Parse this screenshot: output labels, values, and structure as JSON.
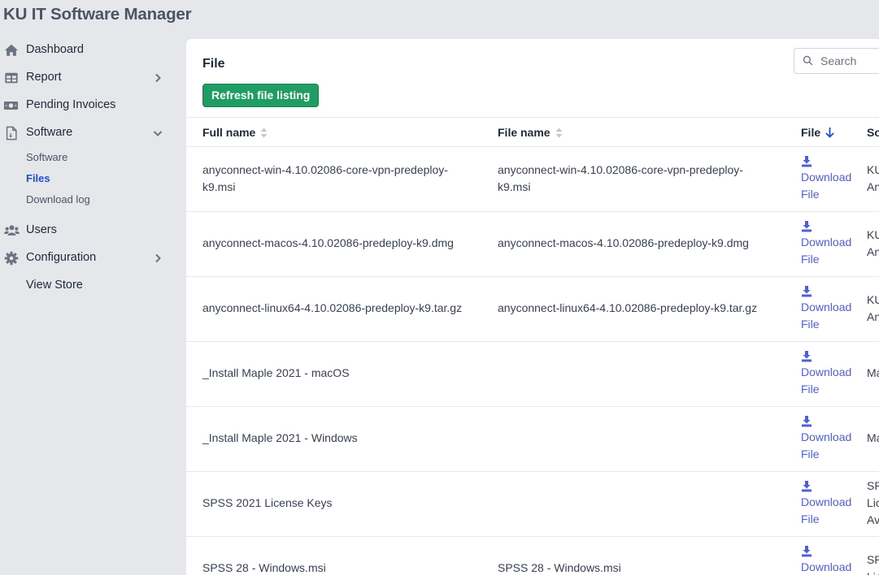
{
  "app": {
    "title": "KU IT Software Manager"
  },
  "sidebar": {
    "items": [
      {
        "label": "Dashboard",
        "icon": "home-icon"
      },
      {
        "label": "Report",
        "icon": "table-icon"
      },
      {
        "label": "Pending Invoices",
        "icon": "money-icon"
      },
      {
        "label": "Software",
        "icon": "file-icon",
        "expanded": true
      },
      {
        "label": "Users",
        "icon": "users-icon"
      },
      {
        "label": "Configuration",
        "icon": "gear-icon"
      },
      {
        "label": "View Store"
      }
    ],
    "software_sub": [
      {
        "label": "Software"
      },
      {
        "label": "Files",
        "active": true
      },
      {
        "label": "Download log"
      }
    ]
  },
  "panel": {
    "title": "File",
    "refresh_label": "Refresh file listing",
    "search_placeholder": "Search",
    "colors": {
      "accent_green": "#1f9d63",
      "link": "#4f5fd8",
      "active_nav": "#1d4ed8"
    }
  },
  "table": {
    "columns": [
      {
        "label": "Full name",
        "sort": "none"
      },
      {
        "label": "File name",
        "sort": "none"
      },
      {
        "label": "File",
        "sort": "descending"
      },
      {
        "label": "So"
      }
    ],
    "download_label_1": "Download",
    "download_label_2": "File",
    "rows": [
      {
        "full_line1": "anyconnect-win-4.10.02086-core-vpn-predeploy-",
        "full_line2": "k9.msi",
        "file_line1": "anyconnect-win-4.10.02086-core-vpn-predeploy-",
        "file_line2": "k9.msi",
        "src_line1": "KU",
        "src_line2": "An",
        "src_line3": ""
      },
      {
        "full_line1": "anyconnect-macos-4.10.02086-predeploy-k9.dmg",
        "full_line2": "",
        "file_line1": "anyconnect-macos-4.10.02086-predeploy-k9.dmg",
        "file_line2": "",
        "src_line1": "KU",
        "src_line2": "An",
        "src_line3": ""
      },
      {
        "full_line1": "anyconnect-linux64-4.10.02086-predeploy-k9.tar.gz",
        "full_line2": "",
        "file_line1": "anyconnect-linux64-4.10.02086-predeploy-k9.tar.gz",
        "file_line2": "",
        "src_line1": "KU",
        "src_line2": "An",
        "src_line3": ""
      },
      {
        "full_line1": "_Install Maple 2021 - macOS",
        "full_line2": "",
        "file_line1": "",
        "file_line2": "",
        "src_line1": "Ma",
        "src_line2": "",
        "src_line3": ""
      },
      {
        "full_line1": "_Install Maple 2021 - Windows",
        "full_line2": "",
        "file_line1": "",
        "file_line2": "",
        "src_line1": "Ma",
        "src_line2": "",
        "src_line3": ""
      },
      {
        "full_line1": "SPSS 2021 License Keys",
        "full_line2": "",
        "file_line1": "",
        "file_line2": "",
        "src_line1": "SP",
        "src_line2": "Lic",
        "src_line3": "Av"
      },
      {
        "full_line1": "SPSS 28 - Windows.msi",
        "full_line2": "",
        "file_line1": "SPSS 28 - Windows.msi",
        "file_line2": "",
        "src_line1": "SP",
        "src_line2": "Lic",
        "src_line3": ""
      }
    ]
  }
}
